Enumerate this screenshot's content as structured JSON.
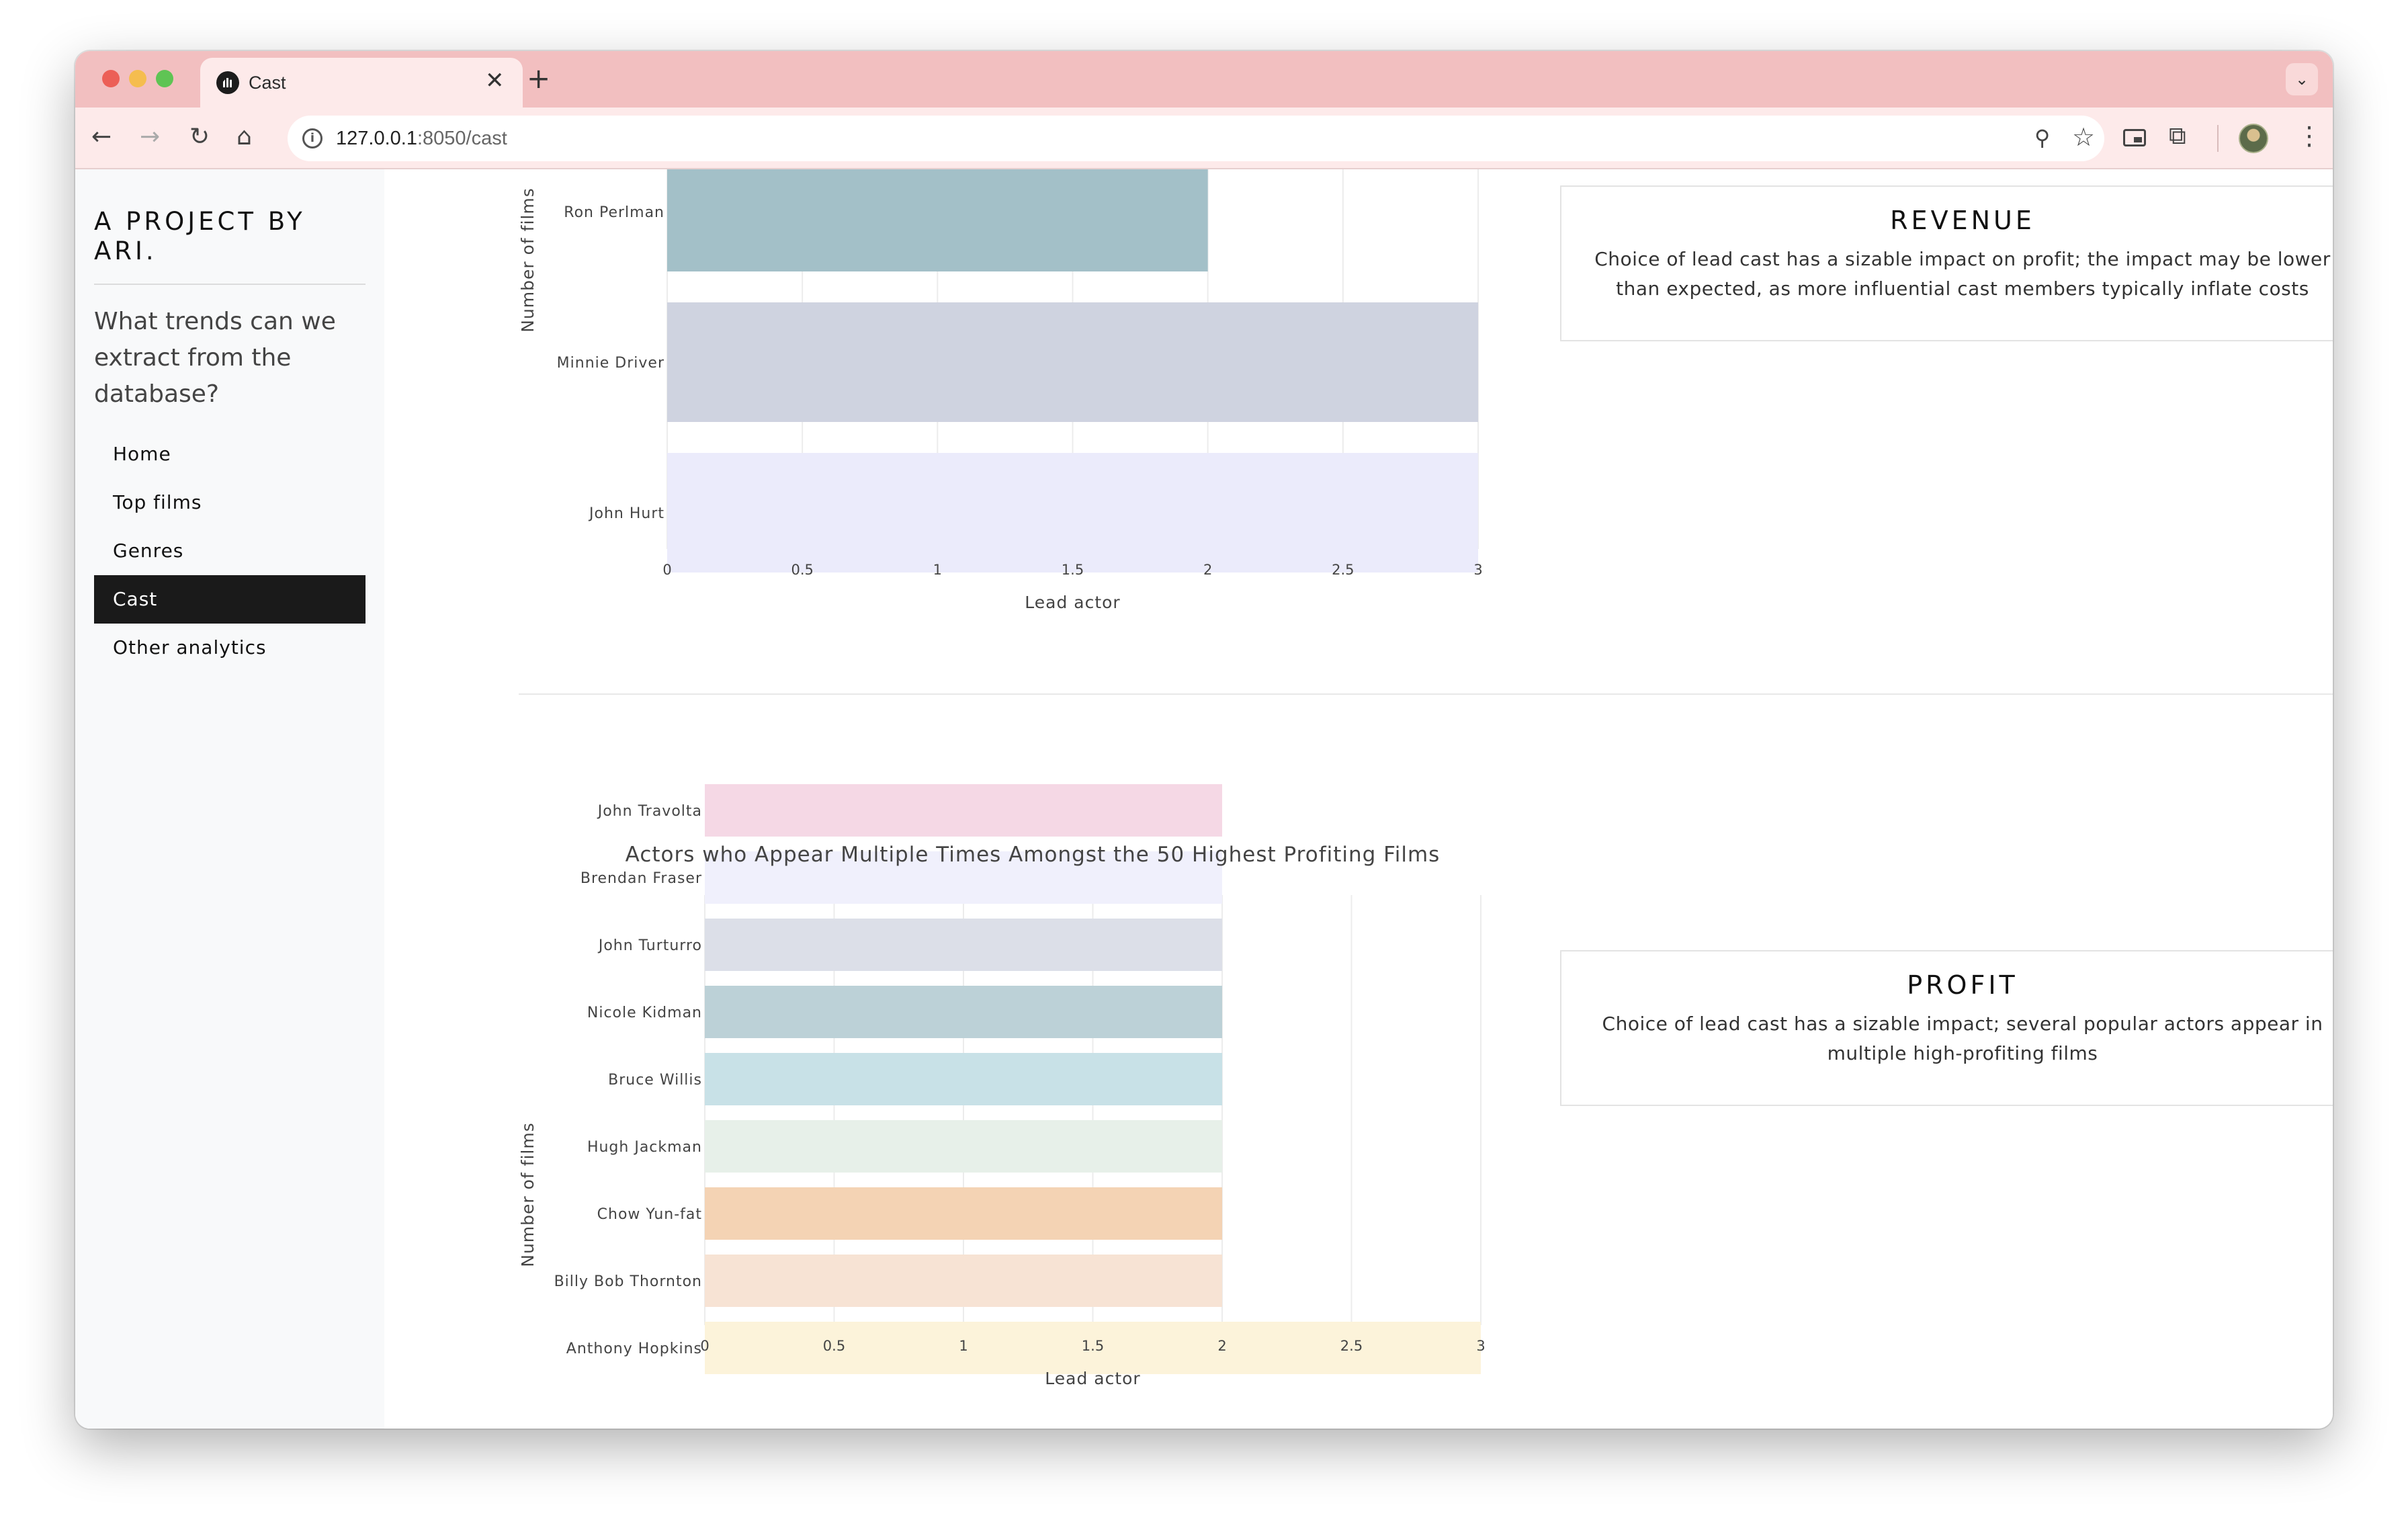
{
  "browser": {
    "tab_title": "Cast",
    "tab_close": "✕",
    "new_tab": "+",
    "tab_list": "⌄",
    "url_host": "127.0.0.1",
    "url_rest": ":8050/cast",
    "icons": {
      "back": "←",
      "forward": "→",
      "reload": "↻",
      "home": "⌂",
      "zoom": "⚲",
      "star": "☆",
      "extensions": "⧉",
      "menu": "⋮"
    }
  },
  "sidebar": {
    "brand": "A PROJECT BY ARI.",
    "lead": "What trends can we extract from the database?",
    "nav": [
      {
        "label": "Home",
        "active": false
      },
      {
        "label": "Top films",
        "active": false
      },
      {
        "label": "Genres",
        "active": false
      },
      {
        "label": "Cast",
        "active": true
      },
      {
        "label": "Other analytics",
        "active": false
      }
    ]
  },
  "cards": {
    "revenue": {
      "title": "REVENUE",
      "body": "Choice of lead cast has a sizable impact on profit; the impact may be lower than expected, as more influential cast members typically inflate costs"
    },
    "profit": {
      "title": "PROFIT",
      "body": "Choice of lead cast has a sizable impact; several popular actors appear in multiple high-profiting films"
    }
  },
  "chart_data": [
    {
      "type": "bar",
      "orientation": "horizontal",
      "title": "",
      "xlabel": "Lead actor",
      "ylabel": "Number of films",
      "xlim": [
        0,
        3
      ],
      "xticks": [
        "0",
        "0.5",
        "1",
        "1.5",
        "2",
        "2.5",
        "3"
      ],
      "categories": [
        "Ron Perlman",
        "Minnie Driver",
        "John Hurt"
      ],
      "values": [
        2,
        3,
        3
      ],
      "colors": [
        "#a3c0c8",
        "#cfd3e0",
        "#ebebfb"
      ]
    },
    {
      "type": "bar",
      "orientation": "horizontal",
      "title": "Actors who Appear Multiple Times Amongst the 50 Highest Profiting Films",
      "xlabel": "Lead actor",
      "ylabel": "Number of films",
      "xlim": [
        0,
        3
      ],
      "xticks": [
        "0",
        "0.5",
        "1",
        "1.5",
        "2",
        "2.5",
        "3"
      ],
      "categories": [
        "John Travolta",
        "Brendan Fraser",
        "John Turturro",
        "Nicole Kidman",
        "Bruce Willis",
        "Hugh Jackman",
        "Chow Yun-fat",
        "Billy Bob Thornton",
        "Anthony Hopkins"
      ],
      "values": [
        2,
        2,
        2,
        2,
        2,
        2,
        2,
        2,
        3
      ],
      "colors": [
        "#f5d8e5",
        "#f0f0fc",
        "#dcdfe8",
        "#bcd1d7",
        "#c8e1e7",
        "#e7f0e9",
        "#f4d3b4",
        "#f7e3d4",
        "#fcf3da"
      ]
    }
  ]
}
